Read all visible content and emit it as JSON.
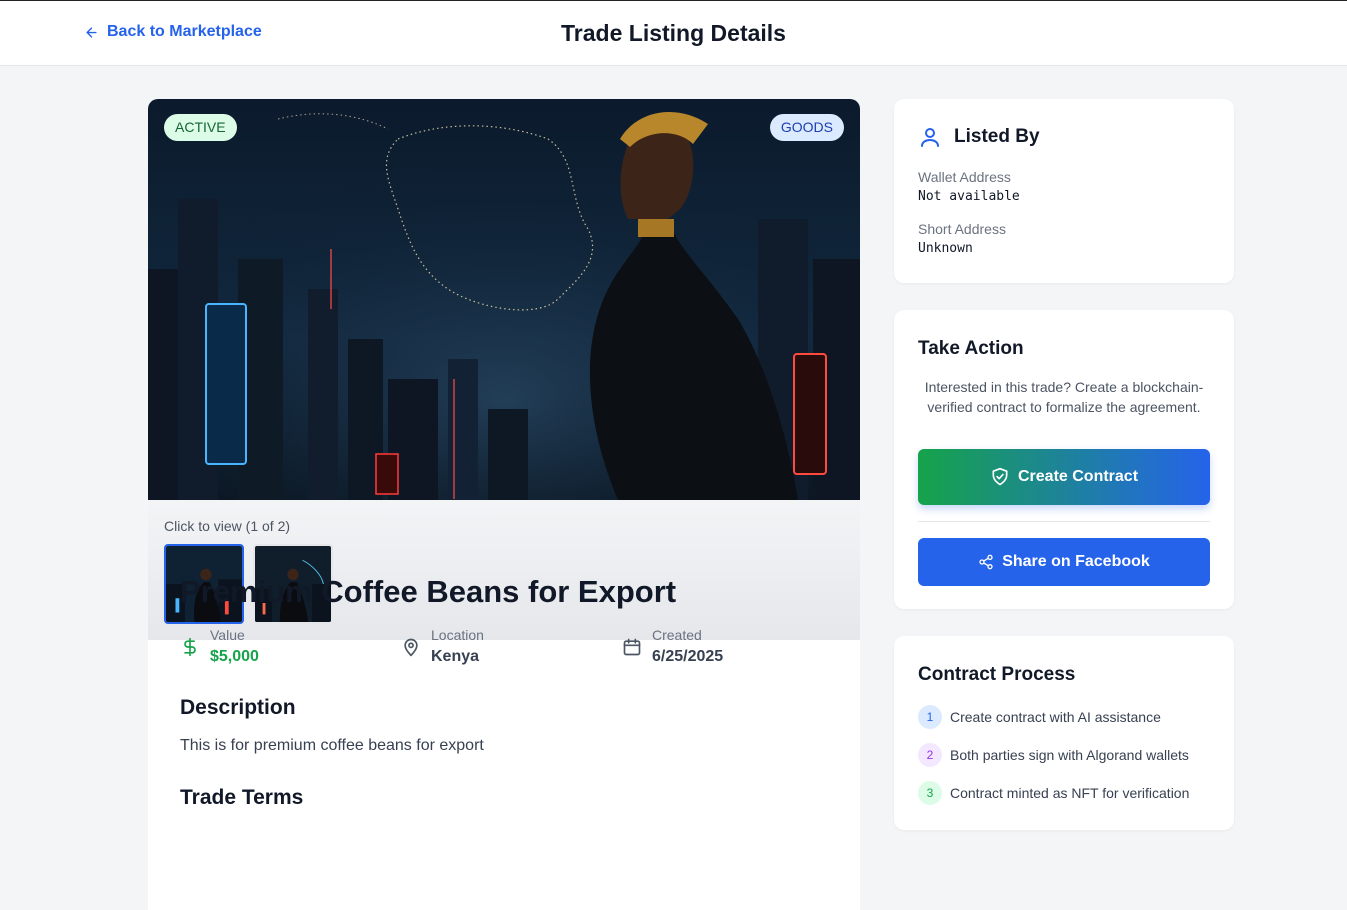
{
  "header": {
    "back_label": "Back to Marketplace",
    "title": "Trade Listing Details"
  },
  "listing": {
    "status_badge": "ACTIVE",
    "category_badge": "GOODS",
    "gallery_caption": "Click to view (1 of 2)",
    "title": "Premium Coffee Beans for Export",
    "value_label": "Value",
    "value": "$5,000",
    "location_label": "Location",
    "location": "Kenya",
    "created_label": "Created",
    "created": "6/25/2025",
    "description_heading": "Description",
    "description": "This is for premium coffee beans for export",
    "trade_terms_heading": "Trade Terms"
  },
  "listed_by": {
    "heading": "Listed By",
    "wallet_label": "Wallet Address",
    "wallet_value": "Not available",
    "short_label": "Short Address",
    "short_value": "Unknown"
  },
  "take_action": {
    "heading": "Take Action",
    "description": "Interested in this trade? Create a blockchain-verified contract to formalize the agreement.",
    "create_contract_label": "Create Contract",
    "share_label": "Share on Facebook"
  },
  "contract_process": {
    "heading": "Contract Process",
    "steps": [
      {
        "num": "1",
        "text": "Create contract with AI assistance"
      },
      {
        "num": "2",
        "text": "Both parties sign with Algorand wallets"
      },
      {
        "num": "3",
        "text": "Contract minted as NFT for verification"
      }
    ]
  },
  "colors": {
    "accent": "#2563eb",
    "success": "#16a34a",
    "background": "#f4f5f7"
  }
}
